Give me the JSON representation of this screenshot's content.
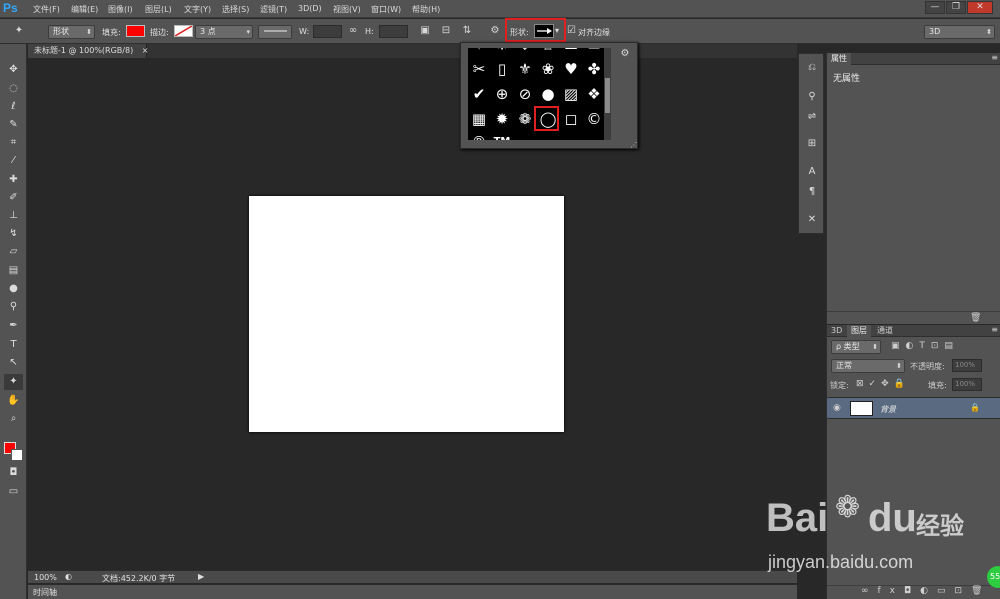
{
  "app": {
    "logo": "Ps"
  },
  "menu": [
    "文件(F)",
    "编辑(E)",
    "图像(I)",
    "图层(L)",
    "文字(Y)",
    "选择(S)",
    "滤镜(T)",
    "3D(D)",
    "视图(V)",
    "窗口(W)",
    "帮助(H)"
  ],
  "window_controls": {
    "minimize": "—",
    "restore": "❐",
    "close": "✕"
  },
  "options": {
    "mode_value": "形状",
    "fill_label": "填充:",
    "fill_color": "#ff0000",
    "stroke_label": "描边:",
    "stroke_width": "3 点",
    "w_label": "W:",
    "h_label": "H:",
    "shape_label": "形状:",
    "align_edges_checked": true,
    "align_edges_label": "对齐边缘",
    "workspace": "3D"
  },
  "document": {
    "tab_title": "未标题-1 @ 100%(RGB/8)",
    "tab_close": "×"
  },
  "status": {
    "zoom": "100%",
    "doc_info": "文档:452.2K/0 字节",
    "timeline_tab": "时间轴"
  },
  "properties": {
    "tab": "属性",
    "content": "无属性"
  },
  "layers": {
    "tabs": [
      "3D",
      "图层",
      "通道"
    ],
    "filter_kind": "ρ 类型",
    "blend_mode": "正常",
    "opacity_label": "不透明度:",
    "opacity_value": "100%",
    "lock_label": "锁定:",
    "fill_label": "填充:",
    "fill_value": "100%",
    "layer_name": "背景"
  },
  "shape_popup": {
    "rows": [
      [
        "scissors-shape",
        "rectangle-frame-shape",
        "fleur-de-lis-shape",
        "flower-bird-shape",
        "heart-shape",
        "puzzle-shape"
      ],
      [
        "check-shape",
        "target-shape",
        "no-sign-shape",
        "speech-bubble-shape",
        "hatch-square-shape",
        "diamond-grid-shape"
      ],
      [
        "grid-shape",
        "starburst-shape",
        "paw-shape",
        "circle-frame-shape",
        "square-frame-shape",
        "copyright-shape"
      ]
    ],
    "partial_bottom": [
      "registered-shape",
      "trademark-shape"
    ],
    "trademark_text": "TM"
  },
  "watermark": {
    "brand_left": "Bai",
    "brand_right": "du",
    "brand_cn": "经验",
    "url": "jingyan.baidu.com",
    "badge": "55"
  },
  "colors": {
    "foreground": "#ff0000",
    "background": "#ffffff",
    "highlight": "#e02020",
    "accent_layer": "#5a6a80"
  }
}
